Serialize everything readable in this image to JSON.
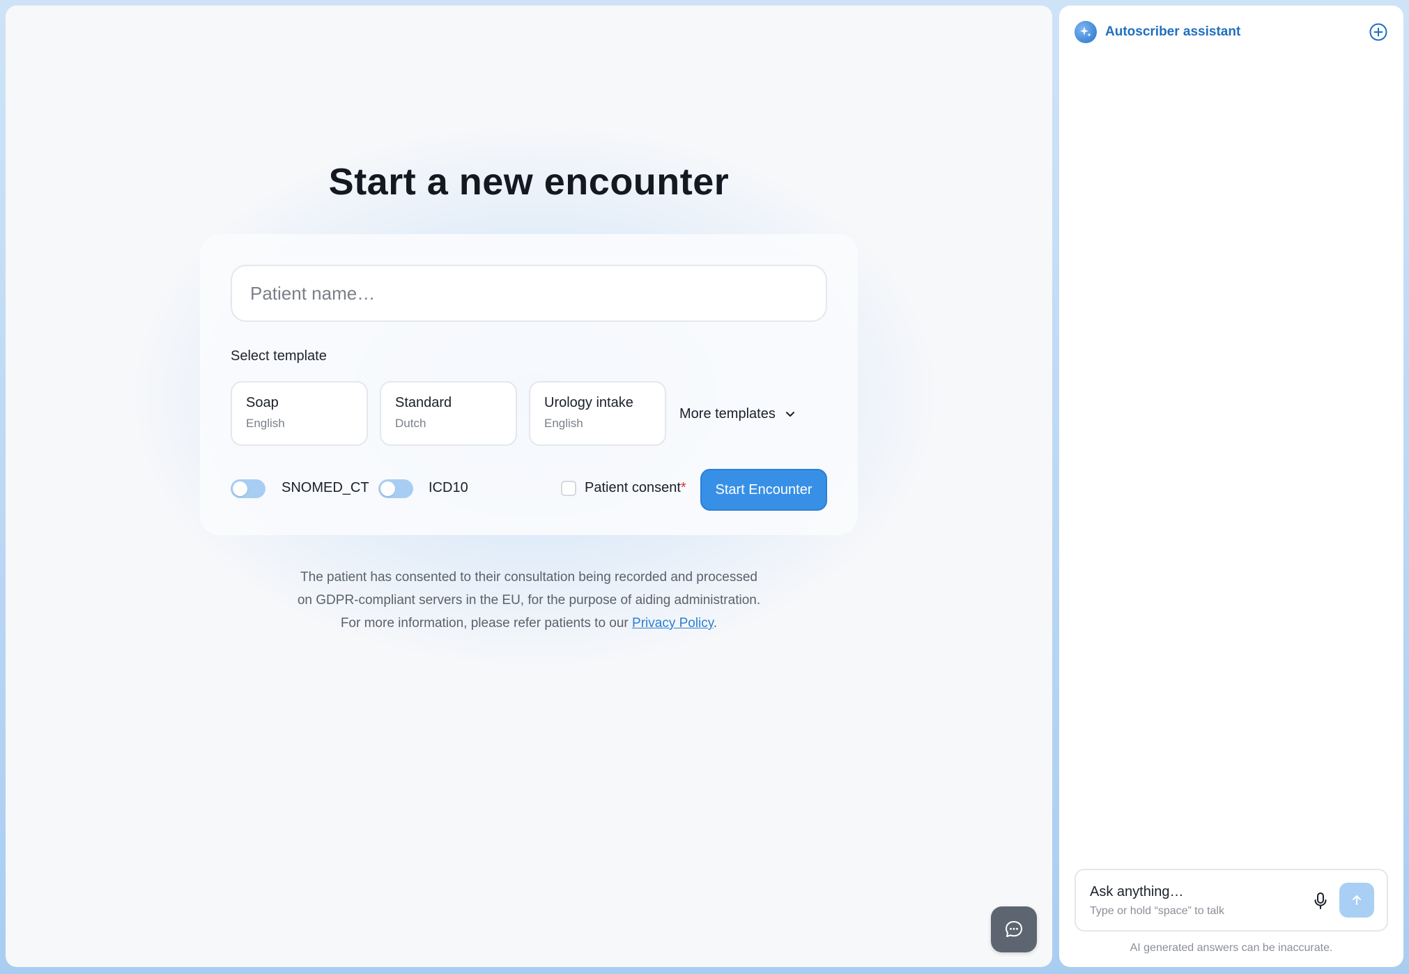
{
  "main": {
    "title": "Start a new encounter",
    "patient_input": {
      "placeholder": "Patient name…",
      "value": ""
    },
    "select_template_label": "Select template",
    "templates": [
      {
        "name": "Soap",
        "language": "English"
      },
      {
        "name": "Standard",
        "language": "Dutch"
      },
      {
        "name": "Urology intake",
        "language": "English"
      }
    ],
    "more_templates_label": "More templates",
    "toggles": [
      {
        "label": "SNOMED_CT",
        "on": false
      },
      {
        "label": "ICD10",
        "on": false
      }
    ],
    "consent": {
      "label": "Patient consent",
      "required_mark": "*",
      "checked": false
    },
    "start_button_label": "Start Encounter",
    "disclaimer": {
      "line1": "The patient has consented to their consultation being recorded and processed",
      "line2": "on GDPR-compliant servers in the EU, for the purpose of aiding administration.",
      "line3_prefix": "For more information, please refer patients to our",
      "link_text": "Privacy Policy",
      "line3_suffix": "."
    },
    "chat_fab_icon": "chat-bubble-icon"
  },
  "assistant": {
    "title": "Autoscriber assistant",
    "logo_icon": "sparkle-icon",
    "new_chat_icon": "plus-circle-icon",
    "ask_placeholder": "Ask anything…",
    "ask_hint": "Type or hold “space” to talk",
    "mic_icon": "microphone-icon",
    "send_icon": "arrow-up-icon",
    "footer_note": "AI generated answers can be inaccurate."
  },
  "colors": {
    "accent": "#3890e6",
    "link": "#2b7fd4",
    "toggle_off": "#a7cdf3",
    "required": "#e0352b",
    "background": "#a9cdf1"
  }
}
